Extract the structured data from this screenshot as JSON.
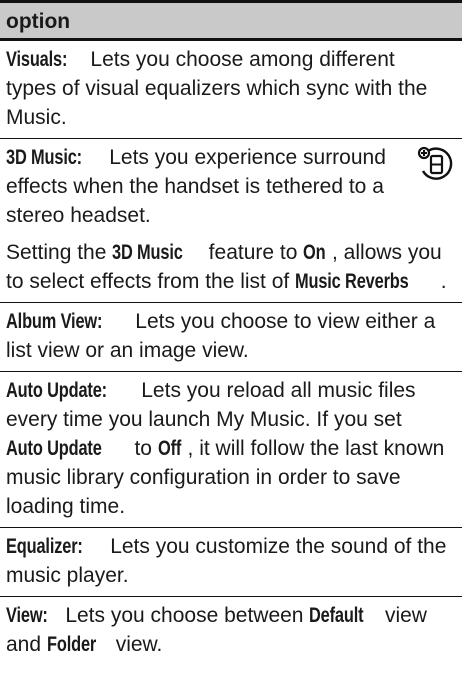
{
  "header": {
    "title": "option"
  },
  "rows": {
    "visuals": {
      "term": "Visuals:",
      "text": " Lets you choose among different types of visual equalizers which sync with the Music."
    },
    "music3d": {
      "term": "3D Music:",
      "text": " Lets you experience surround effects when the handset is tethered to a stereo headset.",
      "icon": "network-feature-icon",
      "note_a": "Setting the ",
      "note_term1": "3D Music",
      "note_b": " feature to ",
      "note_term2": "On",
      "note_c": ", allows you to select effects from the list of ",
      "note_term3": "Music Reverbs",
      "note_d": "."
    },
    "album": {
      "term": "Album View:",
      "text": " Lets you choose to view either a list view or an image view."
    },
    "auto": {
      "term": "Auto Update:",
      "text_a": " Lets you reload all music files every time you launch My Music. If you set ",
      "term2": "Auto Update",
      "text_b": " to ",
      "term3": "Off",
      "text_c": ", it will follow the last known music library configuration in order to save loading time."
    },
    "equalizer": {
      "term": "Equalizer:",
      "text": " Lets you customize the sound of the music player."
    },
    "view": {
      "term": "View:",
      "text_a": " Lets you choose between ",
      "term2": "Default",
      "text_b": " view and ",
      "term3": "Folder",
      "text_c": " view."
    }
  }
}
